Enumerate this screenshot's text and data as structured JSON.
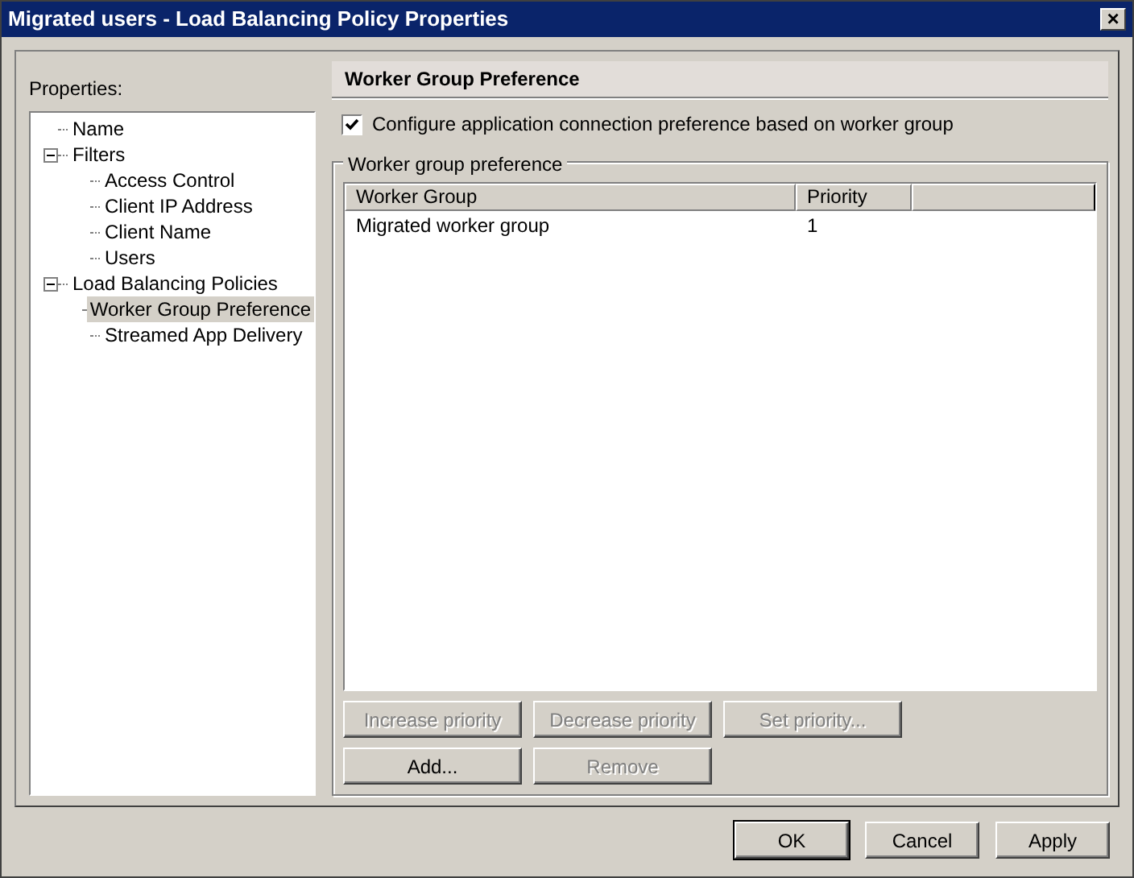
{
  "window": {
    "title": "Migrated users - Load Balancing Policy Properties",
    "close": "×"
  },
  "sidebar": {
    "label": "Properties:",
    "items": [
      {
        "label": "Name",
        "selected": false
      },
      {
        "label": "Filters",
        "selected": false,
        "expanded": true,
        "children": [
          {
            "label": "Access Control",
            "selected": false
          },
          {
            "label": "Client IP Address",
            "selected": false
          },
          {
            "label": "Client Name",
            "selected": false
          },
          {
            "label": "Users",
            "selected": false
          }
        ]
      },
      {
        "label": "Load Balancing Policies",
        "selected": false,
        "expanded": true,
        "children": [
          {
            "label": "Worker Group Preference",
            "selected": true
          },
          {
            "label": "Streamed App Delivery",
            "selected": false
          }
        ]
      }
    ]
  },
  "panel": {
    "title": "Worker Group Preference",
    "checkbox": {
      "label": "Configure application connection preference based on worker group",
      "checked": true
    },
    "group": {
      "title": "Worker group preference",
      "table": {
        "columns": [
          "Worker Group",
          "Priority"
        ],
        "rows": [
          [
            "Migrated worker group",
            "1"
          ]
        ]
      },
      "buttons": [
        [
          {
            "label": "Increase priority",
            "disabled": true
          },
          {
            "label": "Decrease priority",
            "disabled": true
          },
          {
            "label": "Set priority...",
            "disabled": true
          }
        ],
        [
          {
            "label": "Add...",
            "disabled": false
          },
          {
            "label": "Remove",
            "disabled": true
          }
        ]
      ]
    }
  },
  "footer": {
    "buttons": [
      {
        "label": "OK",
        "default": true
      },
      {
        "label": "Cancel",
        "default": false
      },
      {
        "label": "Apply",
        "default": false
      }
    ]
  }
}
